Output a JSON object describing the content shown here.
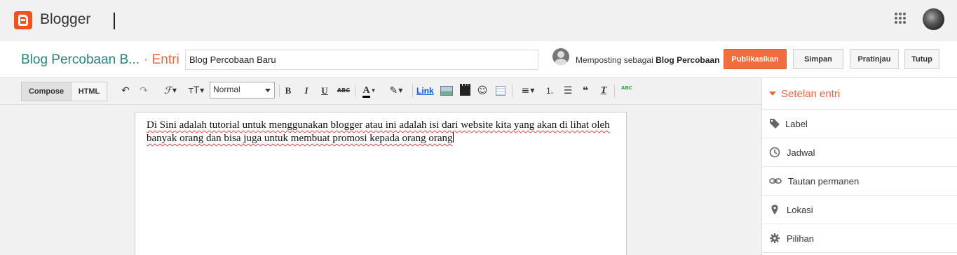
{
  "app": {
    "name": "Blogger",
    "brand_color": "#f4511e"
  },
  "post_header": {
    "blog_name": "Blog Percobaan B...",
    "breadcrumb": "· Entri",
    "title_value": "Blog Percobaan Baru",
    "posting_as_prefix": "Memposting sebagai",
    "posting_as_name": "Blog Percobaan",
    "buttons": {
      "publish": "Publikasikan",
      "save": "Simpan",
      "preview": "Pratinjau",
      "close": "Tutup"
    },
    "publish_color": "#f26d3d",
    "blog_name_color": "#2a7e7e"
  },
  "toolbar": {
    "compose": "Compose",
    "html": "HTML",
    "format_value": "Normal",
    "link": "Link",
    "glyphs": {
      "undo": "↶",
      "redo": "↷",
      "font": "ℱ",
      "text_size": "ᴛT",
      "bold": "B",
      "italic": "I",
      "underline": "U",
      "strike": "ABC",
      "text_color": "A",
      "highlight": "✎",
      "emoji": "☺",
      "align": "≡",
      "numbered_list": "⒈",
      "bullet_list": "☰",
      "quote": "❝",
      "remove_format": "T",
      "spellcheck": "ABC"
    }
  },
  "editor": {
    "content": "Di Sini adalah tutorial untuk menggunakan blogger atau ini adalah isi dari website kita yang akan di lihat oleh banyak orang dan bisa juga untuk membuat promosi kepada orang orang"
  },
  "sidebar": {
    "title": "Setelan entri",
    "accent": "#e8663d",
    "items": [
      {
        "label": "Label",
        "icon": "label-tag-icon"
      },
      {
        "label": "Jadwal",
        "icon": "clock-icon"
      },
      {
        "label": "Tautan permanen",
        "icon": "link-icon"
      },
      {
        "label": "Lokasi",
        "icon": "location-pin-icon"
      },
      {
        "label": "Pilihan",
        "icon": "gear-icon"
      }
    ]
  }
}
